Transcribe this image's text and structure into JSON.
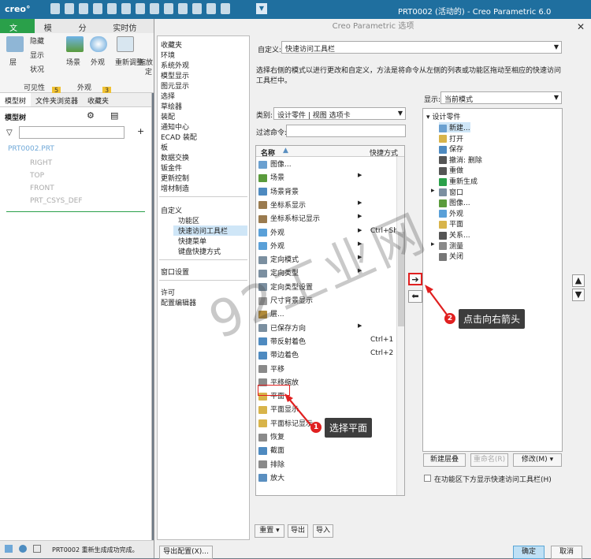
{
  "titlebar": {
    "logo": "creo°",
    "title": "PRT0002 (活动的) - Creo Parametric 6.0"
  },
  "ribbon": {
    "tabs": [
      "文件",
      "模型",
      "分析",
      "实时仿真"
    ],
    "hide_label": "隐藏",
    "display_label": "显示",
    "status_label": "状况",
    "layer_label": "层",
    "scene_label": "场景",
    "appearance_label": "外观",
    "regen_label": "重新调整",
    "zoom_label": "缩放",
    "fix_label": "定",
    "group_visibility": "可见性",
    "group_visibility_badge": "5",
    "group_appearance": "外观",
    "group_appearance_badge": "3"
  },
  "left_panel": {
    "tabs": [
      "模型树",
      "文件夹浏览器",
      "收藏夹"
    ],
    "tree_header": "模型树",
    "items": [
      "PRT0002.PRT",
      "RIGHT",
      "TOP",
      "FRONT",
      "PRT_CSYS_DEF"
    ]
  },
  "status_bar": {
    "message": "PRT0002 重新生成成功完成。"
  },
  "dialog": {
    "title": "Creo Parametric 选项",
    "categories": [
      "收藏夹",
      "环境",
      "系统外观",
      "模型显示",
      "图元显示",
      "选择",
      "草绘器",
      "装配",
      "通知中心",
      "ECAD 装配",
      "板",
      "数据交换",
      "钣金件",
      "更新控制",
      "增材制造"
    ],
    "custom_group": "自定义",
    "custom_items": [
      "功能区",
      "快速访问工具栏",
      "快捷菜单",
      "键盘快捷方式"
    ],
    "window_settings": "窗口设置",
    "license": "许可",
    "config_editor": "配置编辑器",
    "customize_label": "自定义:",
    "customize_value": "快速访问工具栏",
    "description": "选择右侧的模式以进行更改和自定义，方法是将命令从左侧的列表或功能区拖动至相应的快速访问工具栏中。",
    "category_label": "类别:",
    "category_value": "设计零件 | 视图 选项卡",
    "filter_label": "过滤命令:",
    "filter_value": "",
    "display_label": "显示:",
    "display_value": "当前模式",
    "col_name": "名称",
    "col_shortcut": "快捷方式",
    "commands": [
      {
        "name": "图像...",
        "shortcut": ""
      },
      {
        "name": "场景",
        "shortcut": ""
      },
      {
        "name": "场景背景",
        "shortcut": ""
      },
      {
        "name": "坐标系显示",
        "shortcut": ""
      },
      {
        "name": "坐标系标记显示",
        "shortcut": ""
      },
      {
        "name": "外观",
        "shortcut": "Ctrl+Shift"
      },
      {
        "name": "外观",
        "shortcut": ""
      },
      {
        "name": "定向模式",
        "shortcut": ""
      },
      {
        "name": "定向类型",
        "shortcut": ""
      },
      {
        "name": "定向类型设置",
        "shortcut": ""
      },
      {
        "name": "尺寸背景显示",
        "shortcut": ""
      },
      {
        "name": "层...",
        "shortcut": ""
      },
      {
        "name": "已保存方向",
        "shortcut": ""
      },
      {
        "name": "带反射着色",
        "shortcut": "Ctrl+1"
      },
      {
        "name": "带边着色",
        "shortcut": "Ctrl+2"
      },
      {
        "name": "平移",
        "shortcut": ""
      },
      {
        "name": "平移缩放",
        "shortcut": ""
      },
      {
        "name": "平面",
        "shortcut": ""
      },
      {
        "name": "平面显示",
        "shortcut": ""
      },
      {
        "name": "平面标记显示",
        "shortcut": ""
      },
      {
        "name": "恢复",
        "shortcut": ""
      },
      {
        "name": "截面",
        "shortcut": ""
      },
      {
        "name": "排除",
        "shortcut": ""
      },
      {
        "name": "放大",
        "shortcut": ""
      }
    ],
    "toolbar_tree": {
      "root": "设计零件",
      "items": [
        "新建...",
        "打开",
        "保存",
        "撤消: 删除",
        "重做",
        "重新生成",
        "窗口",
        "图像...",
        "外观",
        "平面",
        "关系...",
        "测量",
        "关闭"
      ]
    },
    "buttons": {
      "new_group": "新建层叠",
      "rename": "重命名(R)",
      "modify": "修改(M)",
      "show_below": "在功能区下方显示快速访问工具栏(H)",
      "reset": "重置",
      "export": "导出",
      "import": "导入",
      "export_config": "导出配置(X)...",
      "ok": "确定",
      "cancel": "取消"
    }
  },
  "annotations": {
    "step1_num": "1",
    "step1_text": "选择平面",
    "step2_num": "2",
    "step2_text": "点击向右箭头",
    "watermark": "92工业网"
  },
  "colors": {
    "title_bar": "#1f6f9f",
    "accent_green": "#2aa04a",
    "highlight_red": "#e02020",
    "selection": "#cfe6f7"
  }
}
